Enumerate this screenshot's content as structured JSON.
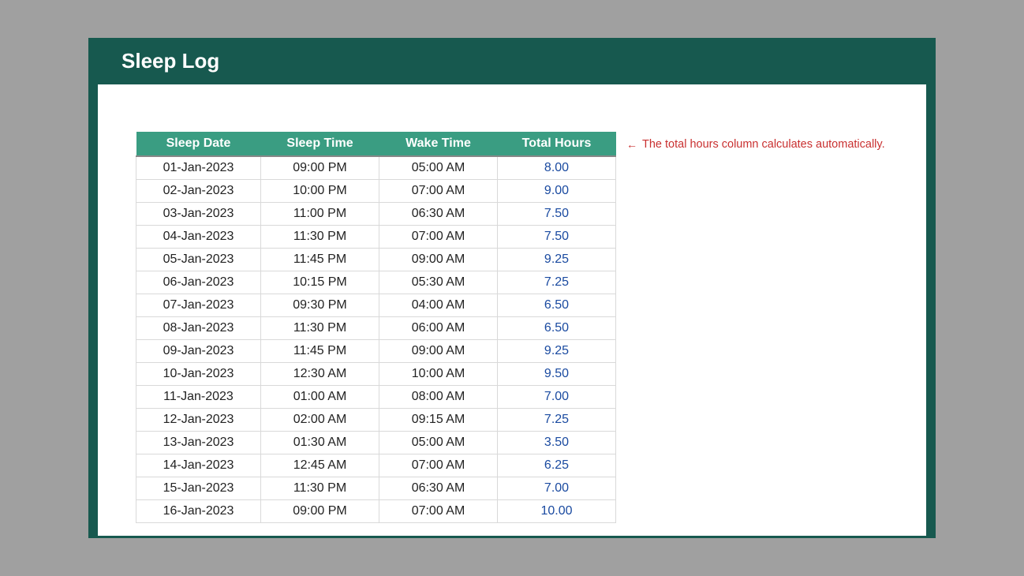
{
  "title": "Sleep Log",
  "note_text": "The total hours column calculates automatically.",
  "headers": {
    "date": "Sleep Date",
    "sleep": "Sleep Time",
    "wake": "Wake Time",
    "total": "Total Hours"
  },
  "rows": [
    {
      "date": "01-Jan-2023",
      "sleep": "09:00 PM",
      "wake": "05:00 AM",
      "total": "8.00"
    },
    {
      "date": "02-Jan-2023",
      "sleep": "10:00 PM",
      "wake": "07:00 AM",
      "total": "9.00"
    },
    {
      "date": "03-Jan-2023",
      "sleep": "11:00 PM",
      "wake": "06:30 AM",
      "total": "7.50"
    },
    {
      "date": "04-Jan-2023",
      "sleep": "11:30 PM",
      "wake": "07:00 AM",
      "total": "7.50"
    },
    {
      "date": "05-Jan-2023",
      "sleep": "11:45 PM",
      "wake": "09:00 AM",
      "total": "9.25"
    },
    {
      "date": "06-Jan-2023",
      "sleep": "10:15 PM",
      "wake": "05:30 AM",
      "total": "7.25"
    },
    {
      "date": "07-Jan-2023",
      "sleep": "09:30 PM",
      "wake": "04:00 AM",
      "total": "6.50"
    },
    {
      "date": "08-Jan-2023",
      "sleep": "11:30 PM",
      "wake": "06:00 AM",
      "total": "6.50"
    },
    {
      "date": "09-Jan-2023",
      "sleep": "11:45 PM",
      "wake": "09:00 AM",
      "total": "9.25"
    },
    {
      "date": "10-Jan-2023",
      "sleep": "12:30 AM",
      "wake": "10:00 AM",
      "total": "9.50"
    },
    {
      "date": "11-Jan-2023",
      "sleep": "01:00 AM",
      "wake": "08:00 AM",
      "total": "7.00"
    },
    {
      "date": "12-Jan-2023",
      "sleep": "02:00 AM",
      "wake": "09:15 AM",
      "total": "7.25"
    },
    {
      "date": "13-Jan-2023",
      "sleep": "01:30 AM",
      "wake": "05:00 AM",
      "total": "3.50"
    },
    {
      "date": "14-Jan-2023",
      "sleep": "12:45 AM",
      "wake": "07:00 AM",
      "total": "6.25"
    },
    {
      "date": "15-Jan-2023",
      "sleep": "11:30 PM",
      "wake": "06:30 AM",
      "total": "7.00"
    },
    {
      "date": "16-Jan-2023",
      "sleep": "09:00 PM",
      "wake": "07:00 AM",
      "total": "10.00"
    }
  ]
}
